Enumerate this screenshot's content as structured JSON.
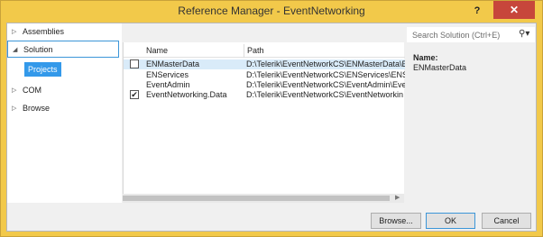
{
  "window": {
    "title": "Reference Manager - EventNetworking",
    "help_glyph": "?",
    "close_glyph": "✕"
  },
  "nav": {
    "items": [
      {
        "label": "Assemblies",
        "arrow": "▷"
      },
      {
        "label": "Solution",
        "arrow": "◢"
      },
      {
        "label": "COM",
        "arrow": "▷"
      },
      {
        "label": "Browse",
        "arrow": "▷"
      }
    ],
    "sub_item": "Projects"
  },
  "list": {
    "headers": {
      "name": "Name",
      "path": "Path"
    },
    "rows": [
      {
        "name": "ENMasterData",
        "path": "D:\\Telerik\\EventNetworkCS\\ENMasterData\\EN",
        "checked": false
      },
      {
        "name": "ENServices",
        "path": "D:\\Telerik\\EventNetworkCS\\ENServices\\ENSe",
        "checked": false
      },
      {
        "name": "EventAdmin",
        "path": "D:\\Telerik\\EventNetworkCS\\EventAdmin\\Eve",
        "checked": false
      },
      {
        "name": "EventNetworking.Data",
        "path": "D:\\Telerik\\EventNetworkCS\\EventNetworkin",
        "checked": true
      }
    ]
  },
  "search": {
    "placeholder": "Search Solution (Ctrl+E)",
    "icon": "search-icon"
  },
  "detail": {
    "label": "Name:",
    "value": "ENMasterData"
  },
  "buttons": {
    "browse": "Browse...",
    "ok": "OK",
    "cancel": "Cancel"
  },
  "colors": {
    "title_bar": "#f2c94a",
    "close_button": "#c7463b",
    "selection": "#3399ea"
  }
}
